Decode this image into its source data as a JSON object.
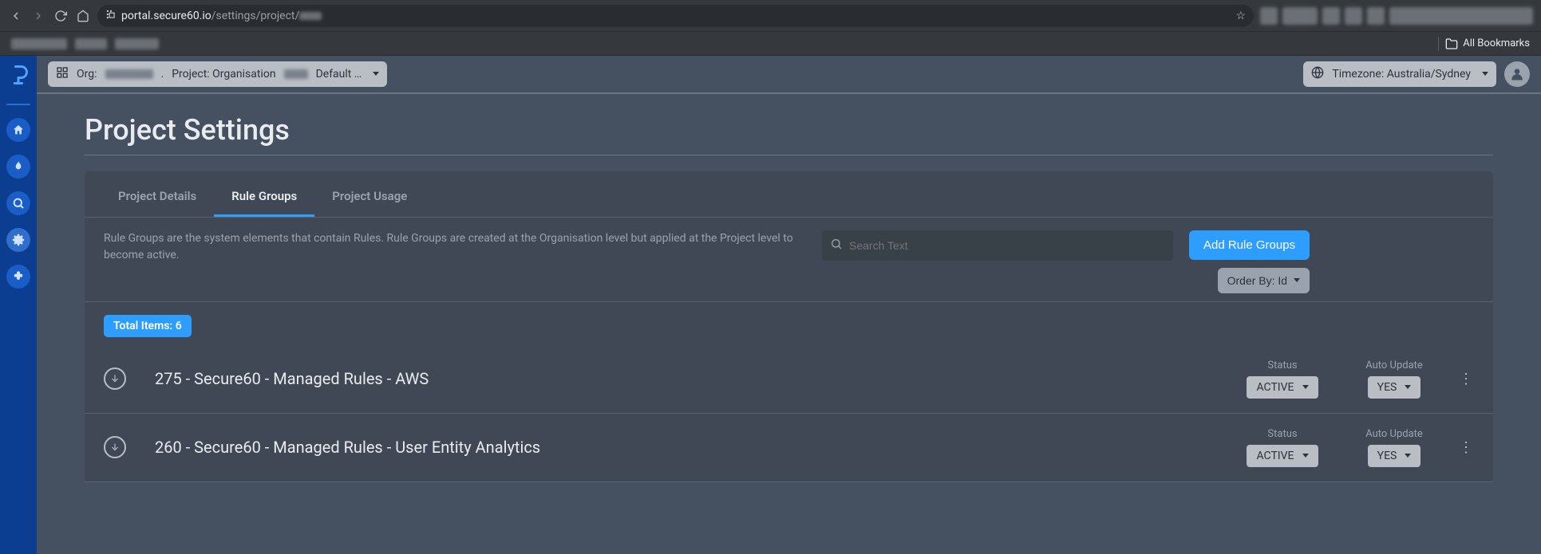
{
  "browser": {
    "url_domain": "portal.secure60.io",
    "url_path": "/settings/project/",
    "bookmarks_all": "All Bookmarks"
  },
  "topbar": {
    "org_label": "Org:",
    "project_label": "Project: Organisation",
    "project_suffix": "Default …",
    "timezone_label": "Timezone: Australia/Sydney"
  },
  "page": {
    "title": "Project Settings"
  },
  "tabs": {
    "details": "Project Details",
    "rule_groups": "Rule Groups",
    "usage": "Project Usage"
  },
  "panel": {
    "description": "Rule Groups are the system elements that contain Rules. Rule Groups are created at the Organisation level but applied at the Project level to become active.",
    "search_placeholder": "Search Text",
    "add_button": "Add Rule Groups",
    "order_by": "Order By: Id"
  },
  "count": {
    "label": "Total Items: 6"
  },
  "columns": {
    "status": "Status",
    "auto_update": "Auto Update"
  },
  "rows": [
    {
      "title": "275 - Secure60 - Managed Rules - AWS",
      "status": "ACTIVE",
      "auto_update": "YES"
    },
    {
      "title": "260 - Secure60 - Managed Rules - User Entity Analytics",
      "status": "ACTIVE",
      "auto_update": "YES"
    }
  ]
}
